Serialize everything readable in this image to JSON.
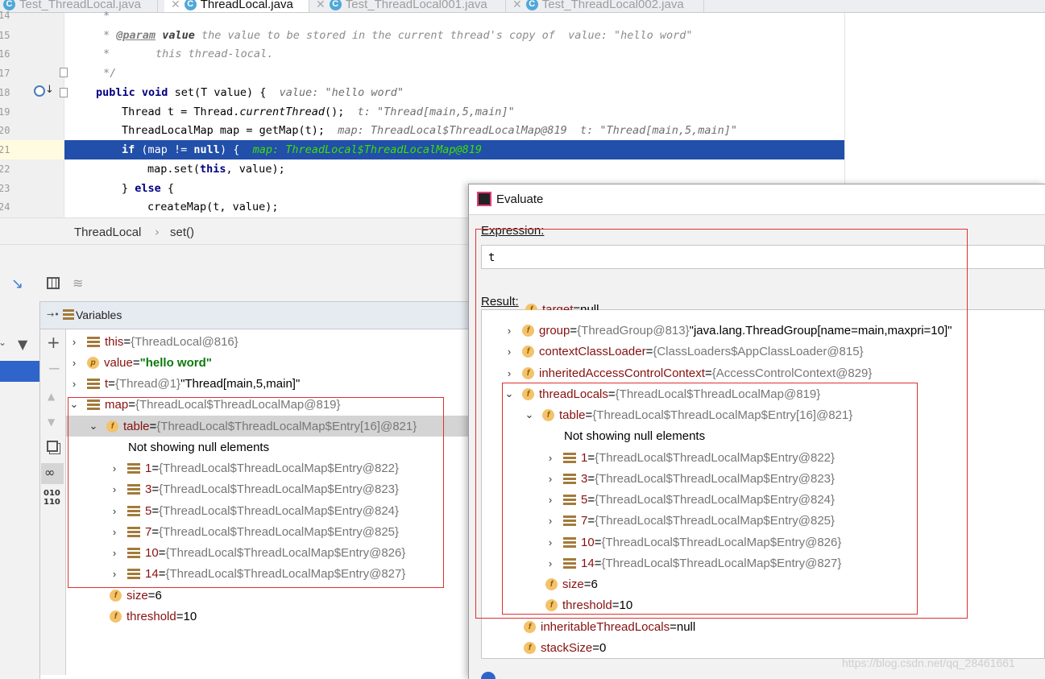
{
  "tabs": [
    {
      "label": "Test_ThreadLocal.java",
      "active": false
    },
    {
      "label": "ThreadLocal.java",
      "active": true
    },
    {
      "label": "Test_ThreadLocal001.java",
      "active": false
    },
    {
      "label": "Test_ThreadLocal002.java",
      "active": false
    }
  ],
  "editor": {
    "lines": [
      {
        "num": "14",
        "code": "*"
      },
      {
        "num": "15",
        "tag": "@param",
        "name": "value",
        "desc": " the value to be stored in the current thread's copy of",
        "hint": "  value: \"hello word\""
      },
      {
        "num": "16",
        "code": "*       this thread-local."
      },
      {
        "num": "17",
        "code": "*/"
      },
      {
        "num": "18",
        "kw1": "public",
        "kw2": "void",
        "sig": " set(T value) {",
        "hint": "  value: \"hello word\""
      },
      {
        "num": "19",
        "a": "Thread t = Thread.",
        "fn": "currentThread",
        "b": "();",
        "hint": "  t: \"Thread[main,5,main]\""
      },
      {
        "num": "20",
        "a": "ThreadLocalMap map = getMap(t);",
        "hint": "  map: ThreadLocal$ThreadLocalMap@819  t: \"Thread[main,5,main]\""
      },
      {
        "num": "21",
        "kw": "if",
        "a": " (map != ",
        "kw2": "null",
        "b": ") {",
        "hint": "  map: ThreadLocal$ThreadLocalMap@819"
      },
      {
        "num": "22",
        "a": "map.set(",
        "kw": "this",
        "b": ", value);"
      },
      {
        "num": "23",
        "a": "} ",
        "kw": "else",
        "b": " {"
      },
      {
        "num": "24",
        "a": "createMap(t, value);"
      }
    ]
  },
  "breadcrumb": {
    "class": "ThreadLocal",
    "method": "set()"
  },
  "variables": {
    "title": "Variables",
    "rows": [
      {
        "name": "this",
        "eq": " = ",
        "val": "{ThreadLocal@816}",
        "extra": ""
      },
      {
        "name": "value",
        "eq": " = ",
        "val": "",
        "str": "\"hello word\""
      },
      {
        "name": "t",
        "eq": " = ",
        "val": "{Thread@1}",
        "extra": " \"Thread[main,5,main]\""
      },
      {
        "name": "map",
        "eq": " = ",
        "val": "{ThreadLocal$ThreadLocalMap@819}"
      },
      {
        "name": "table",
        "eq": " = ",
        "val": "{ThreadLocal$ThreadLocalMap$Entry[16]@821}"
      },
      {
        "text": "Not showing null elements"
      },
      {
        "name": "1",
        "eq": " = ",
        "val": "{ThreadLocal$ThreadLocalMap$Entry@822}"
      },
      {
        "name": "3",
        "eq": " = ",
        "val": "{ThreadLocal$ThreadLocalMap$Entry@823}"
      },
      {
        "name": "5",
        "eq": " = ",
        "val": "{ThreadLocal$ThreadLocalMap$Entry@824}"
      },
      {
        "name": "7",
        "eq": " = ",
        "val": "{ThreadLocal$ThreadLocalMap$Entry@825}"
      },
      {
        "name": "10",
        "eq": " = ",
        "val": "{ThreadLocal$ThreadLocalMap$Entry@826}"
      },
      {
        "name": "14",
        "eq": " = ",
        "val": "{ThreadLocal$ThreadLocalMap$Entry@827}"
      },
      {
        "name": "size",
        "eq": " = ",
        "val": "6"
      },
      {
        "name": "threshold",
        "eq": " = ",
        "val": "10"
      }
    ]
  },
  "evaluate": {
    "title": "Evaluate",
    "expression_label": "Expression:",
    "expression_value": "t",
    "result_label": "Result:",
    "rows": [
      {
        "name": "target",
        "eq": " = ",
        "val": "null"
      },
      {
        "name": "group",
        "eq": " = ",
        "val": "{ThreadGroup@813}",
        "extra": " \"java.lang.ThreadGroup[name=main,maxpri=10]\""
      },
      {
        "name": "contextClassLoader",
        "eq": " = ",
        "val": "{ClassLoaders$AppClassLoader@815}"
      },
      {
        "name": "inheritedAccessControlContext",
        "eq": " = ",
        "val": "{AccessControlContext@829}"
      },
      {
        "name": "threadLocals",
        "eq": " = ",
        "val": "{ThreadLocal$ThreadLocalMap@819}"
      },
      {
        "name": "table",
        "eq": " = ",
        "val": "{ThreadLocal$ThreadLocalMap$Entry[16]@821}"
      },
      {
        "text": "Not showing null elements"
      },
      {
        "name": "1",
        "eq": " = ",
        "val": "{ThreadLocal$ThreadLocalMap$Entry@822}"
      },
      {
        "name": "3",
        "eq": " = ",
        "val": "{ThreadLocal$ThreadLocalMap$Entry@823}"
      },
      {
        "name": "5",
        "eq": " = ",
        "val": "{ThreadLocal$ThreadLocalMap$Entry@824}"
      },
      {
        "name": "7",
        "eq": " = ",
        "val": "{ThreadLocal$ThreadLocalMap$Entry@825}"
      },
      {
        "name": "10",
        "eq": " = ",
        "val": "{ThreadLocal$ThreadLocalMap$Entry@826}"
      },
      {
        "name": "14",
        "eq": " = ",
        "val": "{ThreadLocal$ThreadLocalMap$Entry@827}"
      },
      {
        "name": "size",
        "eq": " = ",
        "val": "6"
      },
      {
        "name": "threshold",
        "eq": " = ",
        "val": "10"
      },
      {
        "name": "inheritableThreadLocals",
        "eq": " = ",
        "val": "null"
      },
      {
        "name": "stackSize",
        "eq": " = ",
        "val": "0"
      }
    ]
  },
  "watermark": "https://blog.csdn.net/qq_28461661",
  "colors": {
    "selection": "#214fa9",
    "accent_red": "#e0302f",
    "field_icon": "#f4c26b"
  }
}
